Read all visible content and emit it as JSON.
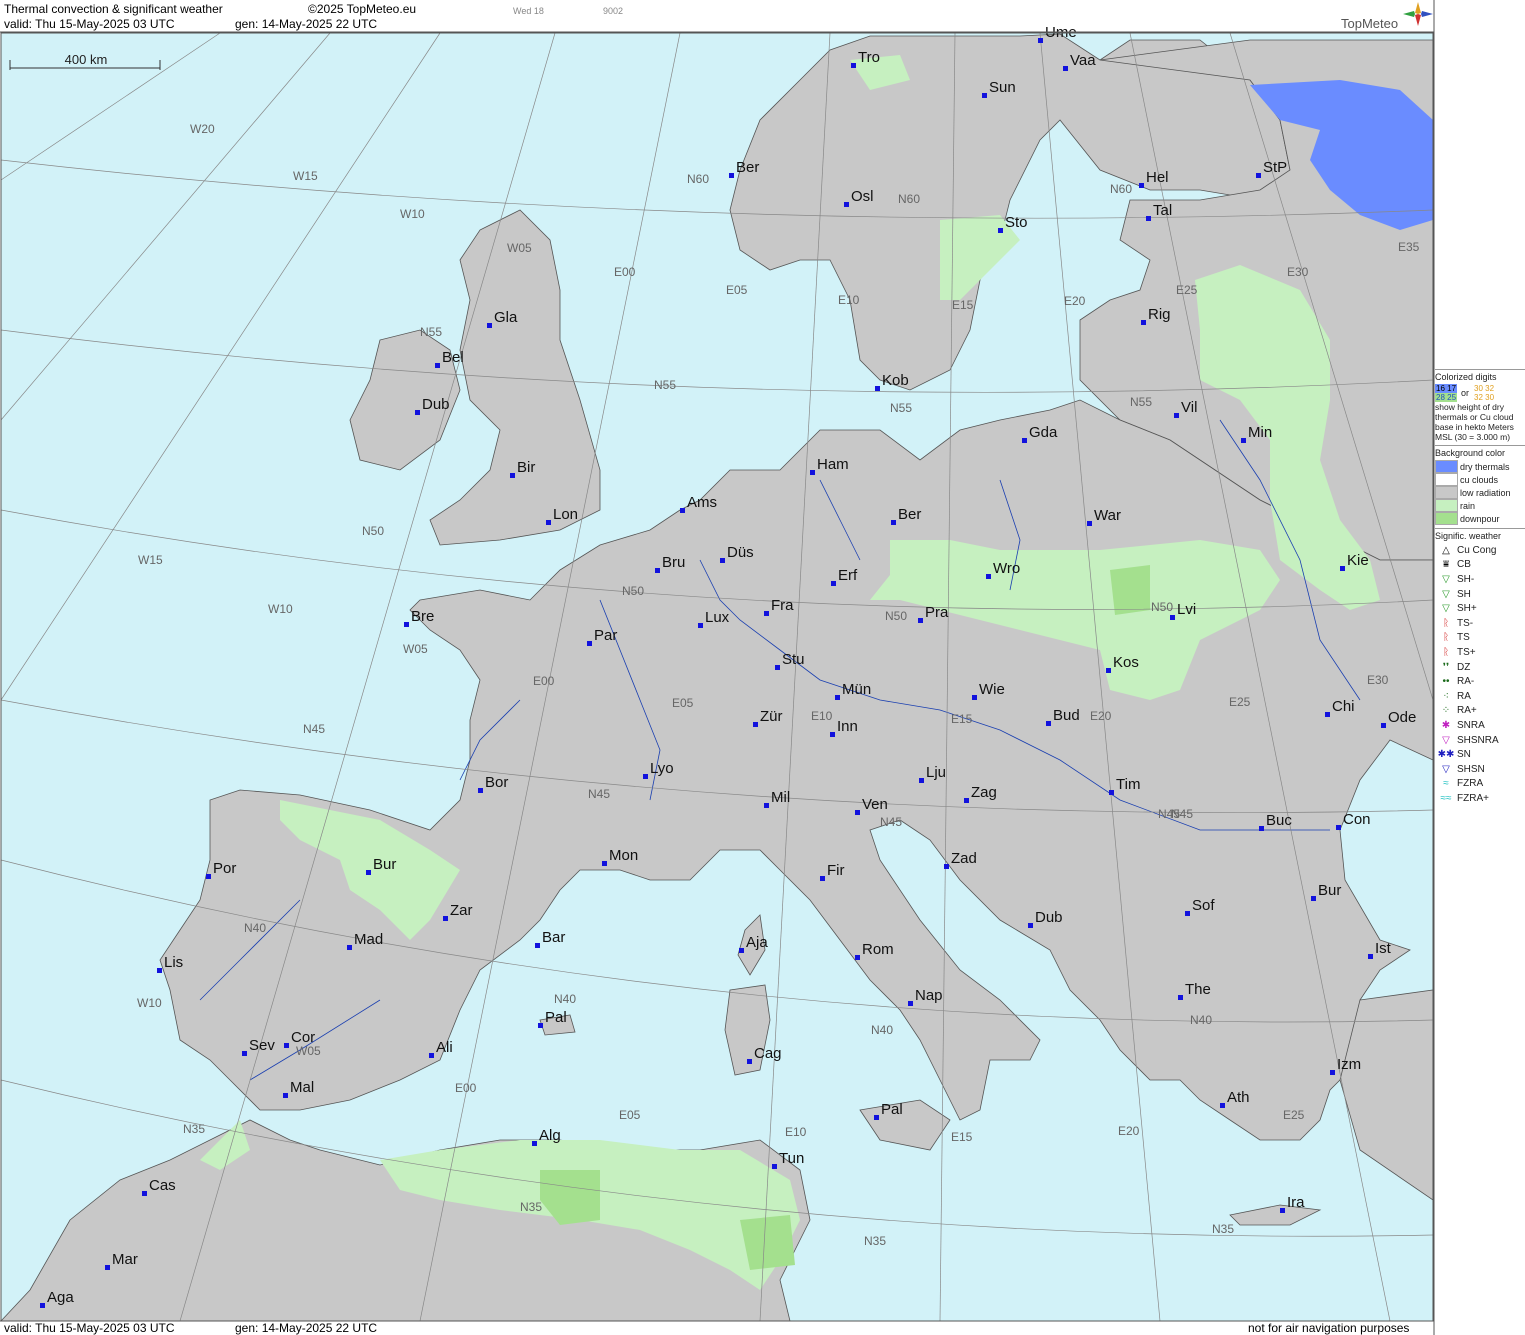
{
  "header": {
    "title": "Thermal convection & significant weather",
    "copyright": "©2025 TopMeteo.eu",
    "day": "Wed 18",
    "code": "9002",
    "valid": "valid:  Thu  15-May-2025  03 UTC",
    "gen": "gen: 14-May-2025 22 UTC",
    "logo": "TopMeteo"
  },
  "footer": {
    "valid": "valid:  Thu  15-May-2025  03 UTC",
    "gen": "gen: 14-May-2025 22 UTC",
    "disclaimer": "not for air navigation purposes"
  },
  "scale": {
    "label": "400 km"
  },
  "colors": {
    "sea": "#d2f2f8",
    "land": "#c8c8c8",
    "border": "#444444",
    "rain": "#c6f0c0",
    "downpour": "#a4e08e",
    "dry_thermals": "#6a8cff",
    "city": "#1212dd",
    "grid": "#888888",
    "river": "#1a3fb0"
  },
  "cities": [
    {
      "n": "Tro"
    },
    {
      "n": "Ume"
    },
    {
      "n": "Vaa"
    },
    {
      "n": "Sun"
    },
    {
      "n": "Ber"
    },
    {
      "n": "Osl"
    },
    {
      "n": "Hel"
    },
    {
      "n": "StP"
    },
    {
      "n": "Sto"
    },
    {
      "n": "Tal"
    },
    {
      "n": "Gla"
    },
    {
      "n": "Rig"
    },
    {
      "n": "Bel"
    },
    {
      "n": "Kob"
    },
    {
      "n": "Dub"
    },
    {
      "n": "Vil"
    },
    {
      "n": "Gda"
    },
    {
      "n": "Min"
    },
    {
      "n": "Ham"
    },
    {
      "n": "Bir"
    },
    {
      "n": "Ams"
    },
    {
      "n": "Ber"
    },
    {
      "n": "Lon"
    },
    {
      "n": "War"
    },
    {
      "n": "Düs"
    },
    {
      "n": "Bru"
    },
    {
      "n": "Erf"
    },
    {
      "n": "Wro"
    },
    {
      "n": "Kie"
    },
    {
      "n": "Fra"
    },
    {
      "n": "Bre"
    },
    {
      "n": "Lux"
    },
    {
      "n": "Pra"
    },
    {
      "n": "Lvi"
    },
    {
      "n": "Par"
    },
    {
      "n": "Stu"
    },
    {
      "n": "Kos"
    },
    {
      "n": "Mün"
    },
    {
      "n": "Wie"
    },
    {
      "n": "Chi"
    },
    {
      "n": "Zür"
    },
    {
      "n": "Inn"
    },
    {
      "n": "Bud"
    },
    {
      "n": "Ode"
    },
    {
      "n": "Lyo"
    },
    {
      "n": "Lju"
    },
    {
      "n": "Bor"
    },
    {
      "n": "Mil"
    },
    {
      "n": "Zag"
    },
    {
      "n": "Tim"
    },
    {
      "n": "Ven"
    },
    {
      "n": "Buc"
    },
    {
      "n": "Con"
    },
    {
      "n": "Bur"
    },
    {
      "n": "Mon"
    },
    {
      "n": "Por"
    },
    {
      "n": "Zad"
    },
    {
      "n": "Fir"
    },
    {
      "n": "Zar"
    },
    {
      "n": "Bur"
    },
    {
      "n": "Sof"
    },
    {
      "n": "Dub"
    },
    {
      "n": "Mad"
    },
    {
      "n": "Bar"
    },
    {
      "n": "Aja"
    },
    {
      "n": "Rom"
    },
    {
      "n": "Ist"
    },
    {
      "n": "Lis"
    },
    {
      "n": "The"
    },
    {
      "n": "Nap"
    },
    {
      "n": "Pal"
    },
    {
      "n": "Cor"
    },
    {
      "n": "Sev"
    },
    {
      "n": "Ali"
    },
    {
      "n": "Cag"
    },
    {
      "n": "Izm"
    },
    {
      "n": "Mal"
    },
    {
      "n": "Ath"
    },
    {
      "n": "Pal"
    },
    {
      "n": "Alg"
    },
    {
      "n": "Tun"
    },
    {
      "n": "Cas"
    },
    {
      "n": "Ira"
    },
    {
      "n": "Mar"
    },
    {
      "n": "Aga"
    }
  ],
  "grid_labels": [
    "W20",
    "W15",
    "W10",
    "W05",
    "E00",
    "E05",
    "E10",
    "E15",
    "E20",
    "E25",
    "E30",
    "E35",
    "N60",
    "N60",
    "N60",
    "N55",
    "N55",
    "N55",
    "N55",
    "N50",
    "N50",
    "N50",
    "N50",
    "W15",
    "W10",
    "W05",
    "E00",
    "E05",
    "E10",
    "E15",
    "E20",
    "E25",
    "E30",
    "N45",
    "N45",
    "N45",
    "N45",
    "N45",
    "N40",
    "N40",
    "N40",
    "N40",
    "W10",
    "W05",
    "E00",
    "E05",
    "E10",
    "E15",
    "E20",
    "E25",
    "N35",
    "N35",
    "N35",
    "N35"
  ],
  "legend": {
    "digits_title": "Colorized digits",
    "digits_a1": "16 17",
    "digits_a2": "28 25",
    "digits_or": "or",
    "digits_b1": "30 32",
    "digits_b2": "32 30",
    "digits_desc": "show height of dry thermals or Cu cloud base in hekto Meters MSL (30 = 3.000 m)",
    "bg_title": "Background color",
    "bg_items": [
      {
        "label": "dry thermals",
        "color": "#6a8cff"
      },
      {
        "label": "cu clouds",
        "color": "#ffffff"
      },
      {
        "label": "low radiation",
        "color": "#c8c8c8"
      },
      {
        "label": "rain",
        "color": "#c6f0c0"
      },
      {
        "label": "downpour",
        "color": "#a4e08e"
      }
    ],
    "sig_title": "Signific. weather",
    "sig_items": [
      {
        "label": "Cu Cong",
        "symbol": "△",
        "color": "#000000"
      },
      {
        "label": "CB",
        "symbol": "⩸",
        "color": "#000000"
      },
      {
        "label": "SH-",
        "symbol": "▽",
        "color": "#2a9a2a"
      },
      {
        "label": "SH",
        "symbol": "▽",
        "color": "#2a9a2a"
      },
      {
        "label": "SH+",
        "symbol": "▽",
        "color": "#2a9a2a"
      },
      {
        "label": "TS-",
        "symbol": "ᚱ",
        "color": "#d02020"
      },
      {
        "label": "TS",
        "symbol": "ᚱ",
        "color": "#d02020"
      },
      {
        "label": "TS+",
        "symbol": "ᚱ",
        "color": "#d02020"
      },
      {
        "label": "DZ",
        "symbol": "❜❜",
        "color": "#1a6a1a"
      },
      {
        "label": "RA-",
        "symbol": "••",
        "color": "#1a6a1a"
      },
      {
        "label": "RA",
        "symbol": "⁖",
        "color": "#1a6a1a"
      },
      {
        "label": "RA+",
        "symbol": "⁘",
        "color": "#1a6a1a"
      },
      {
        "label": "SNRA",
        "symbol": "✱",
        "color": "#c020c0"
      },
      {
        "label": "SHSNRA",
        "symbol": "▽",
        "color": "#c020c0"
      },
      {
        "label": "SN",
        "symbol": "✱✱",
        "color": "#2020c0"
      },
      {
        "label": "SHSN",
        "symbol": "▽",
        "color": "#2020c0"
      },
      {
        "label": "FZRA",
        "symbol": "≈",
        "color": "#20c0c0"
      },
      {
        "label": "FZRA+",
        "symbol": "≈≈",
        "color": "#20c0c0"
      }
    ]
  }
}
